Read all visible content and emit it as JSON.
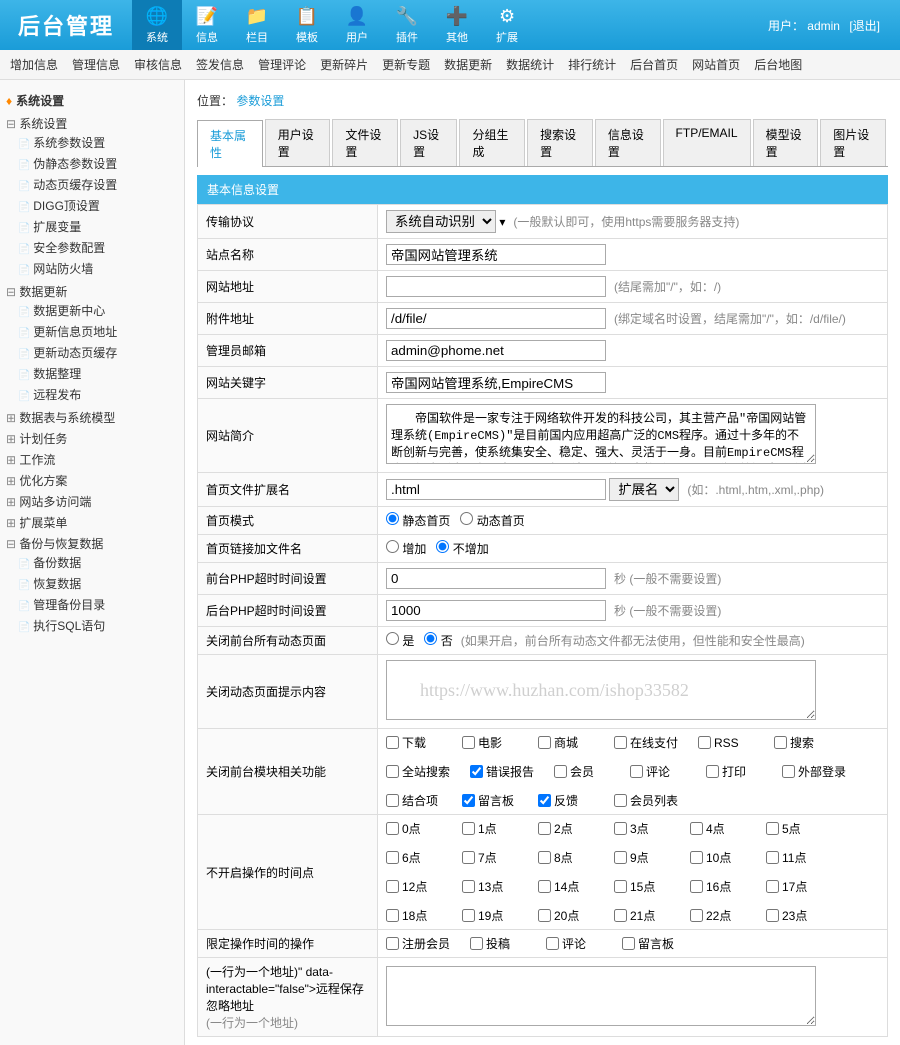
{
  "header": {
    "logo": "后台管理",
    "nav": [
      {
        "label": "系统",
        "icon": "🌐",
        "active": true
      },
      {
        "label": "信息",
        "icon": "📝"
      },
      {
        "label": "栏目",
        "icon": "📁"
      },
      {
        "label": "模板",
        "icon": "📋"
      },
      {
        "label": "用户",
        "icon": "👤"
      },
      {
        "label": "插件",
        "icon": "🔧"
      },
      {
        "label": "其他",
        "icon": "➕"
      },
      {
        "label": "扩展",
        "icon": "⚙"
      }
    ],
    "user_label": "用户：",
    "user_name": "admin",
    "logout": "[退出]"
  },
  "subnav": [
    "增加信息",
    "管理信息",
    "审核信息",
    "签发信息",
    "管理评论",
    "更新碎片",
    "更新专题",
    "数据更新",
    "数据统计",
    "排行统计",
    "后台首页",
    "网站首页",
    "后台地图"
  ],
  "sidebar": {
    "title": "系统设置",
    "groups": [
      {
        "label": "系统设置",
        "expanded": true,
        "items": [
          "系统参数设置",
          "伪静态参数设置",
          "动态页缓存设置",
          "DIGG顶设置",
          "扩展变量",
          "安全参数配置",
          "网站防火墙"
        ]
      },
      {
        "label": "数据更新",
        "expanded": true,
        "items": [
          "数据更新中心",
          "更新信息页地址",
          "更新动态页缓存",
          "数据整理",
          "远程发布"
        ]
      },
      {
        "label": "数据表与系统模型",
        "expanded": false
      },
      {
        "label": "计划任务",
        "expanded": false
      },
      {
        "label": "工作流",
        "expanded": false
      },
      {
        "label": "优化方案",
        "expanded": false
      },
      {
        "label": "网站多访问端",
        "expanded": false
      },
      {
        "label": "扩展菜单",
        "expanded": false
      },
      {
        "label": "备份与恢复数据",
        "expanded": true,
        "items": [
          "备份数据",
          "恢复数据",
          "管理备份目录",
          "执行SQL语句"
        ]
      }
    ]
  },
  "breadcrumb": {
    "loc_label": "位置：",
    "current": "参数设置"
  },
  "tabs": [
    "基本属性",
    "用户设置",
    "文件设置",
    "JS设置",
    "分组生成",
    "搜索设置",
    "信息设置",
    "FTP/EMAIL",
    "模型设置",
    "图片设置"
  ],
  "active_tab": 0,
  "section_title": "基本信息设置",
  "form": {
    "protocol": {
      "label": "传输协议",
      "value": "系统自动识别",
      "hint": "(一般默认即可，使用https需要服务器支持)"
    },
    "sitename": {
      "label": "站点名称",
      "value": "帝国网站管理系统"
    },
    "siteurl": {
      "label": "网站地址",
      "value": "",
      "hint": "(结尾需加\"/\"，如：/)"
    },
    "fileurl": {
      "label": "附件地址",
      "value": "/d/file/",
      "hint": "(绑定域名时设置，结尾需加\"/\"，如：/d/file/)"
    },
    "email": {
      "label": "管理员邮箱",
      "value": "admin@phome.net"
    },
    "keywords": {
      "label": "网站关键字",
      "value": "帝国网站管理系统,EmpireCMS"
    },
    "intro": {
      "label": "网站简介",
      "value": "　　帝国软件是一家专注于网络软件开发的科技公司，其主营产品\"帝国网站管理系统(EmpireCMS)\"是目前国内应用超高广泛的CMS程序。通过十多年的不断创新与完善，使系统集安全、稳定、强大、灵活于一身。目前EmpireCMS程序已经广泛应用在国内上百万家网站，覆盖国内数千万上网人群，并经过上千家知名网站的严格检测，被称为国内超高安全、"
    },
    "indexext": {
      "label": "首页文件扩展名",
      "value": ".html",
      "select_label": "扩展名",
      "hint": "(如：.html,.htm,.xml,.php)"
    },
    "indexmode": {
      "label": "首页模式",
      "opts": [
        "静态首页",
        "动态首页"
      ],
      "sel": 0
    },
    "linkfile": {
      "label": "首页链接加文件名",
      "opts": [
        "增加",
        "不增加"
      ],
      "sel": 1
    },
    "fronttime": {
      "label": "前台PHP超时时间设置",
      "value": "0",
      "hint": "秒 (一般不需要设置)"
    },
    "backtime": {
      "label": "后台PHP超时时间设置",
      "value": "1000",
      "hint": "秒 (一般不需要设置)"
    },
    "closefront": {
      "label": "关闭前台所有动态页面",
      "opts": [
        "是",
        "否"
      ],
      "sel": 1,
      "hint": "(如果开启，前台所有动态文件都无法使用，但性能和安全性最高)"
    },
    "closemsg": {
      "label": "关闭动态页面提示内容",
      "value": ""
    },
    "closemods": {
      "label": "关闭前台模块相关功能",
      "items": [
        "下载",
        "电影",
        "商城",
        "在线支付",
        "RSS",
        "搜索",
        "全站搜索",
        "错误报告",
        "会员",
        "评论",
        "打印",
        "外部登录",
        "结合项",
        "留言板",
        "反馈",
        "会员列表"
      ],
      "checked": [
        7,
        13,
        14
      ]
    },
    "timepoints": {
      "label": "不开启操作的时间点",
      "items": [
        "0点",
        "1点",
        "2点",
        "3点",
        "4点",
        "5点",
        "6点",
        "7点",
        "8点",
        "9点",
        "10点",
        "11点",
        "12点",
        "13点",
        "14点",
        "15点",
        "16点",
        "17点",
        "18点",
        "19点",
        "20点",
        "21点",
        "22点",
        "23点"
      ]
    },
    "limitops": {
      "label": "限定操作时间的操作",
      "items": [
        "注册会员",
        "投稿",
        "评论",
        "留言板"
      ]
    },
    "ignoreurl": {
      "label": "远程保存忽略地址",
      "sub": "(一行为一个地址)",
      "value": ""
    }
  },
  "watermark": "https://www.huzhan.com/ishop33582"
}
